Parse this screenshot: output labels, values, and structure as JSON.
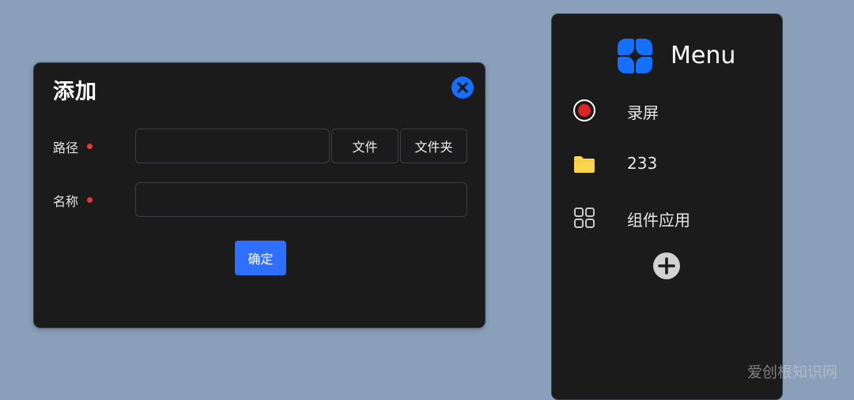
{
  "dialog": {
    "title": "添加",
    "fields": [
      {
        "label": "路径",
        "value": ""
      },
      {
        "label": "名称",
        "value": ""
      }
    ],
    "file_button": "文件",
    "folder_button": "文件夹",
    "confirm_button": "确定"
  },
  "menu": {
    "title": "Menu",
    "items": [
      {
        "label": "录屏",
        "icon": "record-icon"
      },
      {
        "label": "233",
        "icon": "folder-icon"
      },
      {
        "label": "组件应用",
        "icon": "grid-icon"
      }
    ],
    "add_icon": "plus-circle-icon"
  },
  "watermark": "爱创根知识网",
  "colors": {
    "background": "#8a9fba",
    "panel": "#1b1b1b",
    "accent": "#1670ff",
    "confirm": "#2f6fff",
    "required": "#e23b3b",
    "record": "#e02424",
    "folder": "#ffd54f"
  }
}
